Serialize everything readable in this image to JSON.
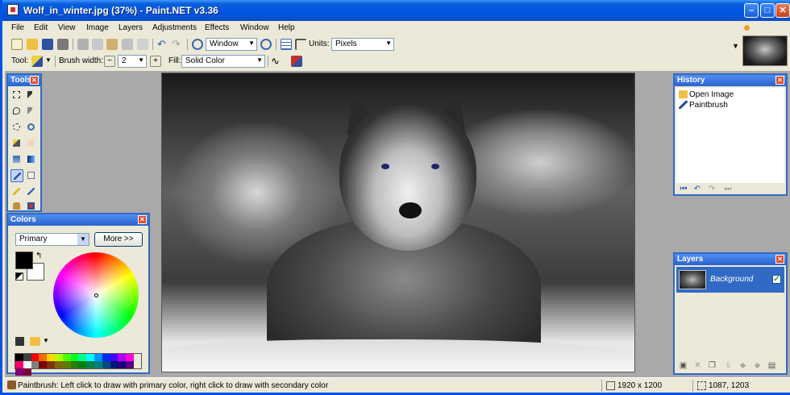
{
  "window": {
    "title": "Wolf_in_winter.jpg (37%) - Paint.NET v3.36",
    "controls": [
      "minimize",
      "maximize",
      "close"
    ]
  },
  "menu": {
    "items": [
      "File",
      "Edit",
      "View",
      "Image",
      "Layers",
      "Adjustments",
      "Effects",
      "Window",
      "Help"
    ]
  },
  "toolbar": {
    "zoom_value": "Window",
    "units_label": "Units:",
    "units_value": "Pixels",
    "tool_label": "Tool:",
    "brush_width_label": "Brush width:",
    "brush_width_value": "2",
    "fill_label": "Fill:",
    "fill_value": "Solid Color"
  },
  "panels": {
    "tools_title": "Tools",
    "colors_title": "Colors",
    "colors_mode": "Primary",
    "more_button": "More >>",
    "history_title": "History",
    "history_items": [
      "Open Image",
      "Paintbrush"
    ],
    "layers_title": "Layers",
    "layers": [
      {
        "name": "Background",
        "visible": true
      }
    ]
  },
  "palette": [
    "#000000",
    "#404040",
    "#ff0000",
    "#ff6a00",
    "#ffd800",
    "#b6ff00",
    "#4cff00",
    "#00ff21",
    "#00ff90",
    "#00ffff",
    "#0094ff",
    "#0026ff",
    "#4800ff",
    "#b200ff",
    "#ff00dc",
    "#ff006e",
    "#ffffff",
    "#808080",
    "#7f0000",
    "#7f3300",
    "#7f6a00",
    "#5b7f00",
    "#267f00",
    "#007f0e",
    "#007f46",
    "#007f7f",
    "#004a7f",
    "#00137f",
    "#21007f",
    "#57007f",
    "#7f006e",
    "#7f0037"
  ],
  "status": {
    "message": "Paintbrush: Left click to draw with primary color, right click to draw with secondary color",
    "image_size": "1920 x 1200",
    "cursor_position": "1087, 1203"
  },
  "colors": {
    "titlebar": "#0054e3",
    "panel_title": "#2a62d0",
    "canvas_bg": "#a9a9a9",
    "primary_color": "#000000",
    "secondary_color": "#ffffff"
  }
}
